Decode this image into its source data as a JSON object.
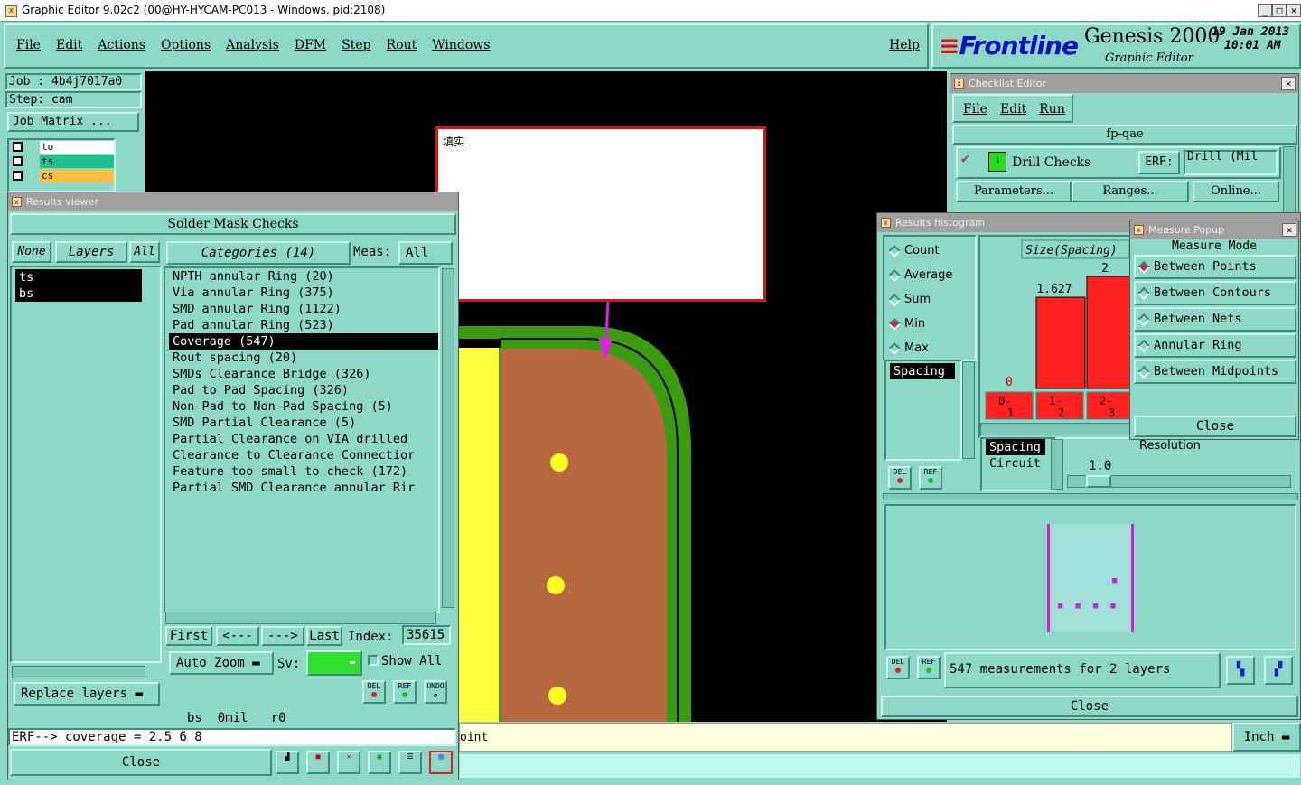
{
  "window": {
    "title": "Graphic Editor 9.02c2 (00@HY-HYCAM-PC013 - Windows, pid:2108)",
    "min": "_",
    "max": "□",
    "close": "✕"
  },
  "menu": {
    "items": [
      "File",
      "Edit",
      "Actions",
      "Options",
      "Analysis",
      "DFM",
      "Step",
      "Rout",
      "Windows"
    ],
    "help": "Help"
  },
  "brand": {
    "logo": "Frontline",
    "product": "Genesis 2000",
    "subtitle": "Graphic Editor",
    "date": "19 Jan 2013",
    "time": "10:01 AM"
  },
  "job": {
    "job": "Job : 4b4j7017a0",
    "step": "Step: cam",
    "matrix": "Job Matrix ..."
  },
  "layers_mini": [
    {
      "name": "to",
      "color": "#ffffff"
    },
    {
      "name": "ts",
      "color": "#20c090"
    },
    {
      "name": "cs",
      "color": "#ffc040"
    }
  ],
  "popup_note": {
    "text": "填实"
  },
  "results_viewer": {
    "title": "Results viewer",
    "heading": "Solder Mask Checks",
    "btn_none": "None",
    "btn_layers": "Layers",
    "btn_all": "All",
    "categories": "Categories (14)",
    "meas_label": "Meas:",
    "meas_value": "All",
    "layers": [
      "ts",
      "bs"
    ],
    "items": [
      "NPTH annular Ring (20)",
      "Via annular Ring (375)",
      "SMD annular Ring (1122)",
      "Pad annular Ring (523)",
      "Coverage (547)",
      "Rout spacing (20)",
      "SMDs Clearance Bridge (326)",
      "Pad to Pad Spacing (326)",
      "Non-Pad to Non-Pad Spacing (5)",
      "SMD Partial Clearance (5)",
      "Partial Clearance on VIA drilled",
      "Clearance to Clearance Connectior",
      "Feature too small to check (172)",
      "Partial SMD Clearance annular Rir"
    ],
    "selected_index": 4,
    "nav": {
      "first": "First",
      "prev": "<---",
      "next": "--->",
      "last": "Last",
      "index_label": "Index:",
      "index_value": "35615"
    },
    "auto_zoom": "Auto Zoom",
    "sv_label": "Sv:",
    "show_all": "Show All",
    "replace_layers": "Replace layers",
    "status": "bs  0mil   r0",
    "erf_line": "ERF--> coverage = 2.5 6 8",
    "close": "Close",
    "icons": {
      "del": "DEL",
      "ref": "REF",
      "undo": "UNDO"
    }
  },
  "checklist": {
    "title": "Checklist Editor",
    "menu": [
      "File",
      "Edit",
      "Run"
    ],
    "name": "fp-qae",
    "drill_checks": "Drill Checks",
    "erf_label": "ERF:",
    "erf_value": "Drill (Mil",
    "buttons": [
      "Parameters...",
      "Ranges...",
      "Online..."
    ]
  },
  "histogram": {
    "title": "Results histogram",
    "modes": [
      "Count",
      "Average",
      "Sum",
      "Min",
      "Max"
    ],
    "selected_mode": "Min",
    "list": [
      "Spacing"
    ],
    "axis_title": "Size(Spacing)",
    "bins": [
      "0-1",
      "1-2",
      "2-3"
    ],
    "low_label": "0",
    "list2": [
      "Spacing",
      "Circuit"
    ],
    "resolution_label": "Resolution",
    "resolution_value": "1.0",
    "measurements": "547 measurements for 2 layers",
    "close": "Close",
    "del": "DEL",
    "ref": "REF"
  },
  "chart_data": {
    "type": "bar",
    "title": "Size(Spacing)",
    "categories": [
      "0-1",
      "1-2",
      "2-3"
    ],
    "values": [
      0,
      1.627,
      2
    ],
    "data_labels": [
      "0",
      "1.627",
      "2"
    ],
    "ylim": [
      0,
      2.2
    ],
    "bar_color": "#ff2020"
  },
  "measure_popup": {
    "title": "Measure Popup",
    "heading": "Measure Mode",
    "modes": [
      "Between Points",
      "Between Contours",
      "Between Nets",
      "Annular Ring",
      "Between Midpoints"
    ],
    "selected": "Between Points",
    "close": "Close"
  },
  "bottom": {
    "prompt": "oint",
    "units": "Inch"
  }
}
